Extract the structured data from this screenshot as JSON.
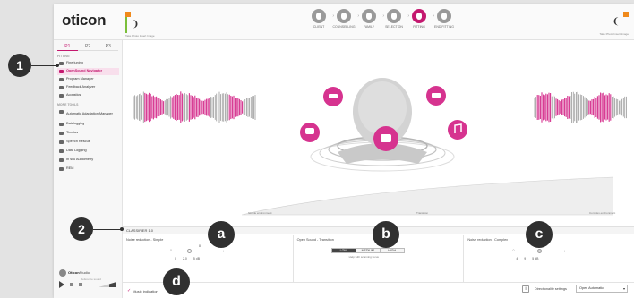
{
  "brand": "oticon",
  "patient": {
    "caption": "Take Photo Insert Image"
  },
  "right_hearing_caption": "Take Photo Insert Image",
  "steps": [
    {
      "label": "CLIENT",
      "active": false
    },
    {
      "label": "COUNSELLING",
      "active": false
    },
    {
      "label": "FAMILY",
      "active": false
    },
    {
      "label": "SELECTION",
      "active": false
    },
    {
      "label": "FITTING",
      "active": true
    },
    {
      "label": "END FITTING",
      "active": false
    }
  ],
  "program_tabs": [
    "P1",
    "P2",
    "P3"
  ],
  "sidebar": {
    "group1": "FITTING",
    "items1": [
      "Fine tuning",
      "OpenSound Navigator",
      "Program Manager",
      "Feedback Analyzer",
      "Acoustics"
    ],
    "group2": "MORE TOOLS",
    "items2": [
      "Automatic Adaptation Manager",
      "Datalogging",
      "Tinnitus",
      "Speech Rescue",
      "Data Logging",
      "In situ Audiometry",
      "REM"
    ],
    "brand_name_strong": "Oticon",
    "brand_name_rest": "Studio",
    "brand_sub": "Reference sound"
  },
  "environment_labels": [
    "Simple environment",
    "Transition",
    "Complex environment"
  ],
  "classifier_bar": "CLASSIFIER 1.0",
  "panels": {
    "a": {
      "title": "Noise reduction - Simple",
      "value": "0",
      "low": "0",
      "ticks": [
        "0",
        "2.0",
        "5 dB"
      ]
    },
    "b": {
      "title": "Open Sound - Transition",
      "value": "0",
      "segments": [
        "LOW",
        "MEDIUM",
        "HIGH"
      ],
      "selected_segment": "LOW",
      "help": "Help with scanning focus"
    },
    "c": {
      "title": "Noise reduction - Complex",
      "value": "0",
      "low": "-0",
      "ticks": [
        "4",
        "9",
        "5 dB"
      ]
    }
  },
  "footer": {
    "music_label": "Music indication",
    "info_label": "i",
    "directionality_label": "Directionality settings",
    "directionality_value": "Open Automatic"
  },
  "callouts": {
    "c1": "1",
    "c2": "2",
    "ca": "a",
    "cb": "b",
    "cc": "c",
    "cd": "d"
  },
  "colors": {
    "accent": "#c4186f",
    "badge": "#303030",
    "wave_gray": "#7a7a7a",
    "wave_pink": "#d6338f"
  }
}
